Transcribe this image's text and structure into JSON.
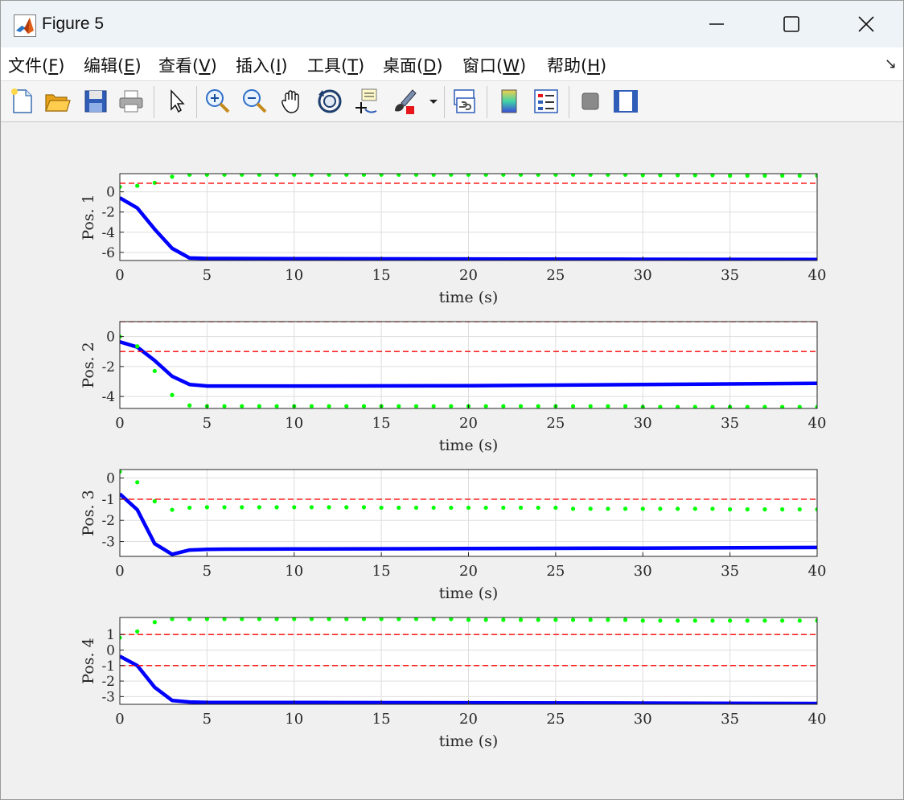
{
  "window": {
    "title": "Figure 5"
  },
  "menu": [
    {
      "label": "文件(",
      "key": "F",
      "close": ")"
    },
    {
      "label": "编辑(",
      "key": "E",
      "close": ")"
    },
    {
      "label": "查看(",
      "key": "V",
      "close": ")"
    },
    {
      "label": "插入(",
      "key": "I",
      "close": ")"
    },
    {
      "label": "工具(",
      "key": "T",
      "close": ")"
    },
    {
      "label": "桌面(",
      "key": "D",
      "close": ")"
    },
    {
      "label": "窗口(",
      "key": "W",
      "close": ")"
    },
    {
      "label": "帮助(",
      "key": "H",
      "close": ")"
    }
  ],
  "toolbar": [
    "new-figure-icon",
    "open-file-icon",
    "save-icon",
    "print-icon",
    "select-pointer-icon",
    "zoom-in-icon",
    "zoom-out-icon",
    "pan-hand-icon",
    "rotate-3d-icon",
    "data-cursor-icon",
    "brush-icon",
    "dropdown-arrow-icon",
    "link-plot-icon",
    "colorbar-icon",
    "legend-icon",
    "hide-plot-tools-icon",
    "show-plot-tools-icon"
  ],
  "colors": {
    "main_line": "#0000ff",
    "dots": "#00ff00",
    "bounds": "#ff0000"
  },
  "chart_data": [
    {
      "type": "line",
      "ylabel": "Pos. 1",
      "xlabel": "time (s)",
      "xlim": [
        0,
        40
      ],
      "ylim": [
        -6.8,
        1.8
      ],
      "xticks": [
        0,
        5,
        10,
        15,
        20,
        25,
        30,
        35,
        40
      ],
      "yticks": [
        0,
        -2,
        -4,
        -6
      ],
      "grid": true,
      "series": [
        {
          "style": "solid-thick",
          "color": "#0000ff",
          "x": [
            0,
            1,
            2,
            3,
            4,
            5,
            6,
            10,
            20,
            30,
            40
          ],
          "y": [
            -0.6,
            -1.6,
            -3.7,
            -5.6,
            -6.55,
            -6.6,
            -6.6,
            -6.62,
            -6.65,
            -6.68,
            -6.7
          ]
        },
        {
          "style": "dots",
          "color": "#00ff00",
          "x": [
            0,
            1,
            2,
            3,
            4,
            5,
            6,
            7,
            8,
            9,
            10,
            11,
            12,
            13,
            14,
            15,
            16,
            17,
            18,
            19,
            20,
            21,
            22,
            23,
            24,
            25,
            26,
            27,
            28,
            29,
            30,
            31,
            32,
            33,
            34,
            35,
            36,
            37,
            38,
            39,
            40
          ],
          "y": [
            0.5,
            0.6,
            0.9,
            1.5,
            1.7,
            1.7,
            1.7,
            1.7,
            1.7,
            1.7,
            1.7,
            1.7,
            1.7,
            1.7,
            1.7,
            1.7,
            1.7,
            1.7,
            1.7,
            1.7,
            1.7,
            1.7,
            1.7,
            1.7,
            1.7,
            1.7,
            1.7,
            1.7,
            1.7,
            1.7,
            1.65,
            1.65,
            1.65,
            1.65,
            1.65,
            1.6,
            1.6,
            1.6,
            1.6,
            1.6,
            1.6
          ]
        },
        {
          "style": "dashed",
          "color": "#ff0000",
          "x": [
            0,
            40
          ],
          "y": [
            0.85,
            0.85
          ]
        }
      ]
    },
    {
      "type": "line",
      "ylabel": "Pos. 2",
      "xlabel": "time (s)",
      "xlim": [
        0,
        40
      ],
      "ylim": [
        -4.8,
        1
      ],
      "xticks": [
        0,
        5,
        10,
        15,
        20,
        25,
        30,
        35,
        40
      ],
      "yticks": [
        0,
        -2,
        -4
      ],
      "grid": true,
      "series": [
        {
          "style": "solid-thick",
          "color": "#0000ff",
          "x": [
            0,
            1,
            2,
            3,
            4,
            5,
            6,
            10,
            20,
            30,
            40
          ],
          "y": [
            -0.35,
            -0.7,
            -1.6,
            -2.65,
            -3.2,
            -3.3,
            -3.3,
            -3.3,
            -3.28,
            -3.2,
            -3.12
          ]
        },
        {
          "style": "dots",
          "color": "#00ff00",
          "x": [
            0,
            1,
            2,
            3,
            4,
            5,
            6,
            7,
            8,
            9,
            10,
            11,
            12,
            13,
            14,
            15,
            16,
            17,
            18,
            19,
            20,
            21,
            22,
            23,
            24,
            25,
            26,
            27,
            28,
            29,
            30,
            31,
            32,
            33,
            34,
            35,
            36,
            37,
            38,
            39,
            40
          ],
          "y": [
            0,
            -0.65,
            -2.3,
            -3.9,
            -4.6,
            -4.65,
            -4.65,
            -4.65,
            -4.65,
            -4.65,
            -4.65,
            -4.65,
            -4.65,
            -4.65,
            -4.65,
            -4.65,
            -4.65,
            -4.65,
            -4.65,
            -4.65,
            -4.65,
            -4.65,
            -4.65,
            -4.65,
            -4.65,
            -4.65,
            -4.65,
            -4.65,
            -4.65,
            -4.65,
            -4.7,
            -4.7,
            -4.7,
            -4.7,
            -4.7,
            -4.7,
            -4.7,
            -4.7,
            -4.7,
            -4.7,
            -4.7
          ]
        },
        {
          "style": "dashed",
          "color": "#ff0000",
          "x": [
            0,
            40
          ],
          "y": [
            1,
            1
          ]
        },
        {
          "style": "dashed",
          "color": "#ff0000",
          "x": [
            0,
            40
          ],
          "y": [
            -1,
            -1
          ]
        }
      ]
    },
    {
      "type": "line",
      "ylabel": "Pos. 3",
      "xlabel": "time (s)",
      "xlim": [
        0,
        40
      ],
      "ylim": [
        -3.7,
        0.4
      ],
      "xticks": [
        0,
        5,
        10,
        15,
        20,
        25,
        30,
        35,
        40
      ],
      "yticks": [
        0,
        -1,
        -2,
        -3
      ],
      "grid": true,
      "series": [
        {
          "style": "solid-thick",
          "color": "#0000ff",
          "x": [
            0,
            1,
            2,
            3,
            4,
            5,
            6,
            10,
            20,
            30,
            40
          ],
          "y": [
            -0.75,
            -1.5,
            -3.1,
            -3.6,
            -3.4,
            -3.37,
            -3.36,
            -3.35,
            -3.33,
            -3.31,
            -3.28
          ]
        },
        {
          "style": "dots",
          "color": "#00ff00",
          "x": [
            0,
            1,
            2,
            3,
            4,
            5,
            6,
            7,
            8,
            9,
            10,
            11,
            12,
            13,
            14,
            15,
            16,
            17,
            18,
            19,
            20,
            21,
            22,
            23,
            24,
            25,
            26,
            27,
            28,
            29,
            30,
            31,
            32,
            33,
            34,
            35,
            36,
            37,
            38,
            39,
            40
          ],
          "y": [
            0.3,
            -0.2,
            -1.1,
            -1.5,
            -1.4,
            -1.38,
            -1.38,
            -1.38,
            -1.38,
            -1.38,
            -1.38,
            -1.38,
            -1.38,
            -1.38,
            -1.38,
            -1.4,
            -1.4,
            -1.4,
            -1.4,
            -1.4,
            -1.4,
            -1.4,
            -1.4,
            -1.4,
            -1.4,
            -1.4,
            -1.45,
            -1.45,
            -1.45,
            -1.45,
            -1.45,
            -1.45,
            -1.45,
            -1.45,
            -1.45,
            -1.48,
            -1.48,
            -1.48,
            -1.48,
            -1.48,
            -1.48
          ]
        },
        {
          "style": "dashed",
          "color": "#ff0000",
          "x": [
            0,
            40
          ],
          "y": [
            -1,
            -1
          ]
        }
      ]
    },
    {
      "type": "line",
      "ylabel": "Pos. 4",
      "xlabel": "time (s)",
      "xlim": [
        0,
        40
      ],
      "ylim": [
        -3.5,
        2.1
      ],
      "xticks": [
        0,
        5,
        10,
        15,
        20,
        25,
        30,
        35,
        40
      ],
      "yticks": [
        1,
        0,
        -1,
        -2,
        -3
      ],
      "grid": true,
      "series": [
        {
          "style": "solid-thick",
          "color": "#0000ff",
          "x": [
            0,
            1,
            2,
            3,
            4,
            5,
            6,
            10,
            20,
            30,
            40
          ],
          "y": [
            -0.4,
            -1.0,
            -2.4,
            -3.25,
            -3.35,
            -3.38,
            -3.38,
            -3.38,
            -3.4,
            -3.42,
            -3.45
          ]
        },
        {
          "style": "dots",
          "color": "#00ff00",
          "x": [
            0,
            1,
            2,
            3,
            4,
            5,
            6,
            7,
            8,
            9,
            10,
            11,
            12,
            13,
            14,
            15,
            16,
            17,
            18,
            19,
            20,
            21,
            22,
            23,
            24,
            25,
            26,
            27,
            28,
            29,
            30,
            31,
            32,
            33,
            34,
            35,
            36,
            37,
            38,
            39,
            40
          ],
          "y": [
            0.8,
            1.2,
            1.8,
            2.0,
            2.0,
            2.0,
            2.0,
            2.0,
            2.0,
            2.0,
            2.0,
            2.0,
            2.0,
            2.0,
            2.0,
            2.0,
            2.0,
            2.0,
            2.0,
            2.0,
            1.95,
            1.95,
            1.95,
            1.95,
            1.95,
            1.95,
            1.95,
            1.95,
            1.95,
            1.95,
            1.9,
            1.9,
            1.9,
            1.9,
            1.9,
            1.9,
            1.9,
            1.9,
            1.9,
            1.9,
            1.9
          ]
        },
        {
          "style": "dashed",
          "color": "#ff0000",
          "x": [
            0,
            40
          ],
          "y": [
            1,
            1
          ]
        },
        {
          "style": "dashed",
          "color": "#ff0000",
          "x": [
            0,
            40
          ],
          "y": [
            -1,
            -1
          ]
        }
      ]
    }
  ]
}
